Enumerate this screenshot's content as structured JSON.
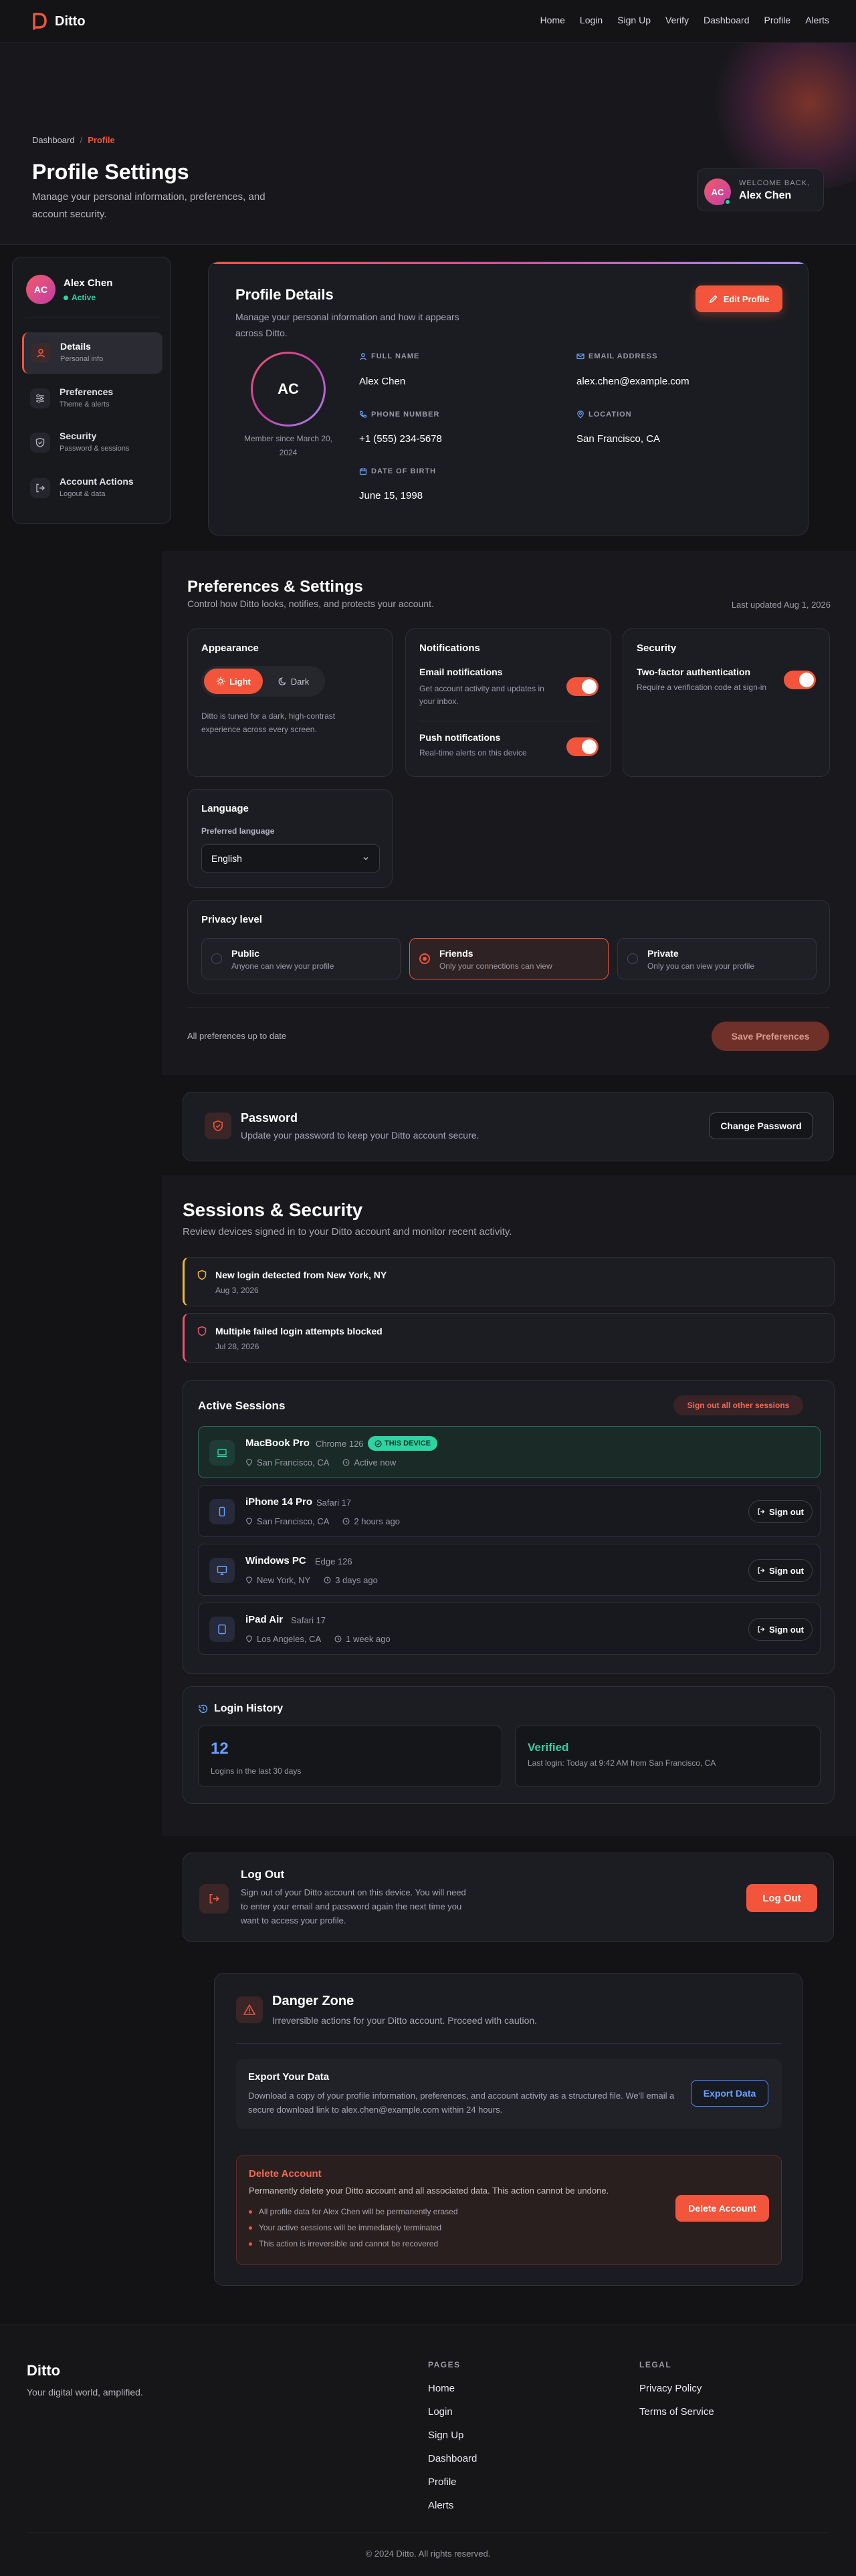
{
  "brand": {
    "name": "Ditto",
    "accent": "#f2553b",
    "tagline": "Your digital world, amplified."
  },
  "nav": [
    "Home",
    "Login",
    "Sign Up",
    "Verify",
    "Dashboard",
    "Profile",
    "Alerts"
  ],
  "hero": {
    "breadcrumb_home": "Dashboard",
    "breadcrumb_sep": "/",
    "breadcrumb_current": "Profile",
    "title": "Profile Settings",
    "subtitle": "Manage your personal information, preferences, and account security.",
    "welcome_label": "WELCOME BACK,",
    "welcome_name": "Alex Chen",
    "initials": "AC"
  },
  "sidebar": {
    "name": "Alex Chen",
    "status": "Active",
    "initials": "AC",
    "items": [
      {
        "label": "Details",
        "sub": "Personal info",
        "icon": "user-icon"
      },
      {
        "label": "Preferences",
        "sub": "Theme & alerts",
        "icon": "sliders-icon"
      },
      {
        "label": "Security",
        "sub": "Password & sessions",
        "icon": "shield-icon"
      },
      {
        "label": "Account Actions",
        "sub": "Logout & data",
        "icon": "logout-icon"
      }
    ]
  },
  "profile": {
    "title": "Profile Details",
    "subtitle": "Manage your personal information and how it appears across Ditto.",
    "edit_label": "Edit Profile",
    "initials": "AC",
    "member_since": "Member since March 20, 2024",
    "fields": {
      "full_name_label": "FULL NAME",
      "full_name": "Alex Chen",
      "email_label": "EMAIL ADDRESS",
      "email": "alex.chen@example.com",
      "phone_label": "PHONE NUMBER",
      "phone": "+1 (555) 234-5678",
      "location_label": "LOCATION",
      "location": "San Francisco, CA",
      "dob_label": "DATE OF BIRTH",
      "dob": "June 15, 1998"
    }
  },
  "prefs": {
    "title": "Preferences & Settings",
    "subtitle": "Control how Ditto looks, notifies, and protects your account.",
    "updated": "Last updated Aug 1, 2026",
    "appearance": {
      "title": "Appearance",
      "light": "Light",
      "dark": "Dark",
      "desc": "Ditto is tuned for a dark, high-contrast experience across every screen."
    },
    "notifications": {
      "title": "Notifications",
      "email_title": "Email notifications",
      "email_desc": "Get account activity and updates in your inbox.",
      "push_title": "Push notifications",
      "push_desc": "Real-time alerts on this device"
    },
    "security": {
      "title": "Security",
      "tfa_title": "Two-factor authentication",
      "tfa_desc": "Require a verification code at sign-in"
    },
    "language": {
      "title": "Language",
      "label": "Preferred language",
      "value": "English"
    },
    "privacy": {
      "title": "Privacy level",
      "options": [
        {
          "title": "Public",
          "desc": "Anyone can view your profile"
        },
        {
          "title": "Friends",
          "desc": "Only your connections can view"
        },
        {
          "title": "Private",
          "desc": "Only you can view your profile"
        }
      ]
    },
    "status": "All preferences up to date",
    "save_label": "Save Preferences"
  },
  "password": {
    "title": "Password",
    "desc": "Update your password to keep your Ditto account secure.",
    "button": "Change Password"
  },
  "sessions": {
    "title": "Sessions & Security",
    "subtitle": "Review devices signed in to your Ditto account and monitor recent activity.",
    "alerts": [
      {
        "title": "New login detected from New York, NY",
        "date": "Aug 3, 2026"
      },
      {
        "title": "Multiple failed login attempts blocked",
        "date": "Jul 28, 2026"
      }
    ],
    "active_title": "Active Sessions",
    "signout_all": "Sign out all other sessions",
    "this_device": "THIS DEVICE",
    "signout": "Sign out",
    "devices": [
      {
        "name": "MacBook Pro",
        "browser": "Chrome 126",
        "location": "San Francisco, CA",
        "time": "Active now"
      },
      {
        "name": "iPhone 14 Pro",
        "browser": "Safari 17",
        "location": "San Francisco, CA",
        "time": "2 hours ago"
      },
      {
        "name": "Windows PC",
        "browser": "Edge 126",
        "location": "New York, NY",
        "time": "3 days ago"
      },
      {
        "name": "iPad Air",
        "browser": "Safari 17",
        "location": "Los Angeles, CA",
        "time": "1 week ago"
      }
    ],
    "history_title": "Login History",
    "logins_count": "12",
    "logins_desc": "Logins in the last 30 days",
    "verified": "Verified",
    "last_login": "Last login: Today at 9:42 AM from San Francisco, CA"
  },
  "logout": {
    "title": "Log Out",
    "desc": "Sign out of your Ditto account on this device. You will need to enter your email and password again the next time you want to access your profile.",
    "button": "Log Out"
  },
  "danger": {
    "title": "Danger Zone",
    "subtitle": "Irreversible actions for your Ditto account. Proceed with caution.",
    "export_title": "Export Your Data",
    "export_desc": "Download a copy of your profile information, preferences, and account activity as a structured file. We'll email a secure download link to alex.chen@example.com within 24 hours.",
    "export_button": "Export Data",
    "delete_title": "Delete Account",
    "delete_desc": "Permanently delete your Ditto account and all associated data. This action cannot be undone.",
    "bullets": [
      "All profile data for Alex Chen will be permanently erased",
      "Your active sessions will be immediately terminated",
      "This action is irreversible and cannot be recovered"
    ],
    "delete_button": "Delete Account"
  },
  "footer": {
    "brand": "Ditto",
    "pages_title": "PAGES",
    "pages": [
      "Home",
      "Login",
      "Sign Up",
      "Dashboard",
      "Profile",
      "Alerts"
    ],
    "legal_title": "LEGAL",
    "legal": [
      "Privacy Policy",
      "Terms of Service"
    ],
    "copyright": "© 2024 Ditto. All rights reserved."
  }
}
